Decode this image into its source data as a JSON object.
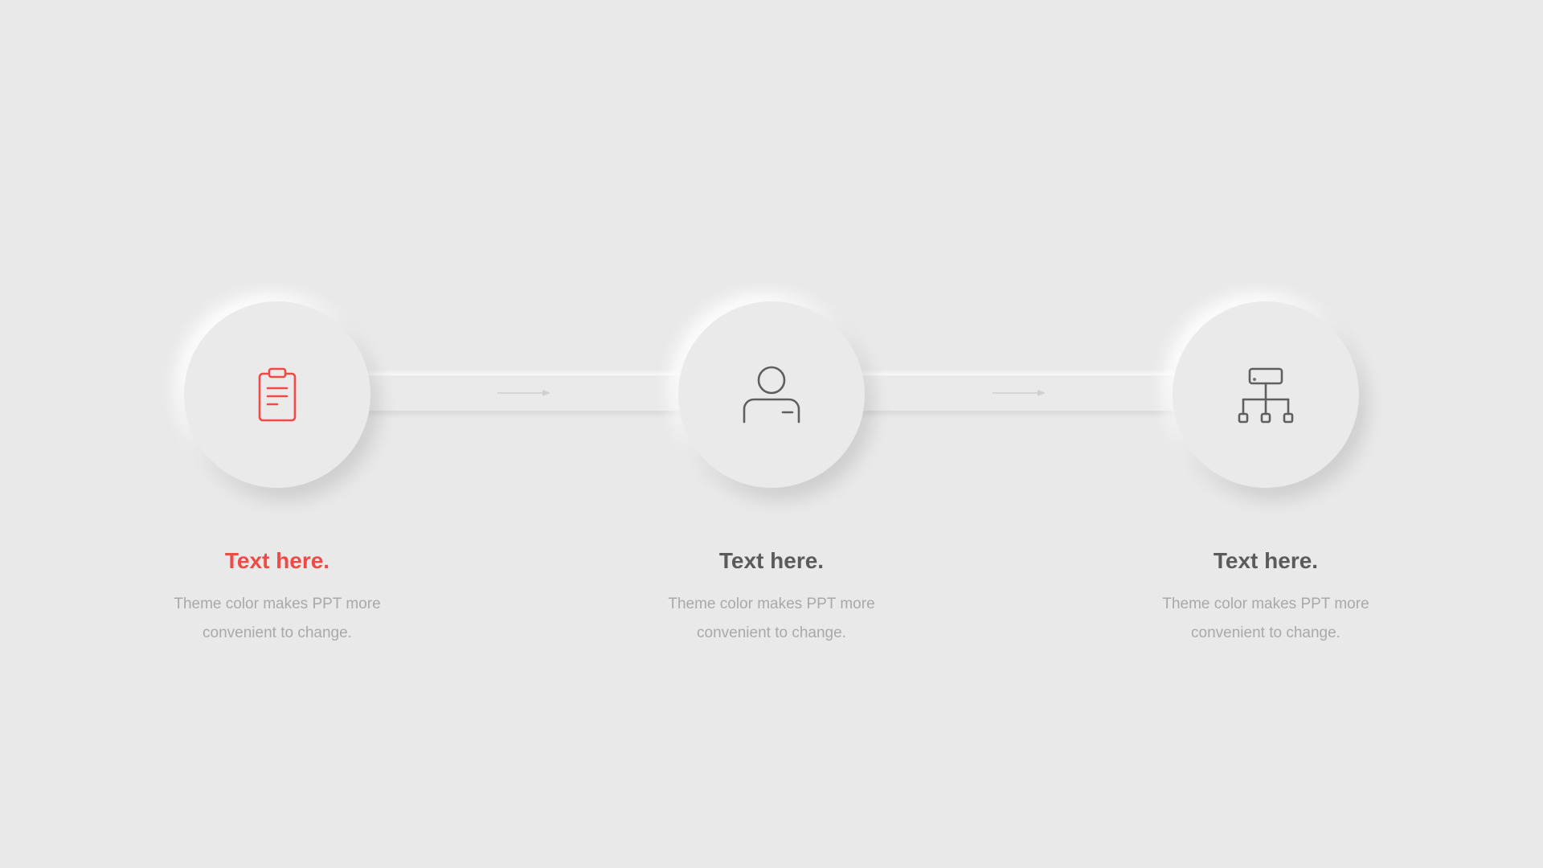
{
  "colors": {
    "background": "#e8e9e8",
    "accent": "#ef4a45",
    "title": "#5b5b5b",
    "description": "#a9a9a9",
    "icon": "#5f5f5f"
  },
  "steps": [
    {
      "icon": "clipboard-icon",
      "title": "Text here.",
      "description": "Theme color makes PPT more convenient to change.",
      "highlighted": true
    },
    {
      "icon": "user-icon",
      "title": "Text here.",
      "description": "Theme color makes PPT more convenient to change.",
      "highlighted": false
    },
    {
      "icon": "org-chart-icon",
      "title": "Text here.",
      "description": "Theme color makes PPT more convenient to change.",
      "highlighted": false
    }
  ]
}
